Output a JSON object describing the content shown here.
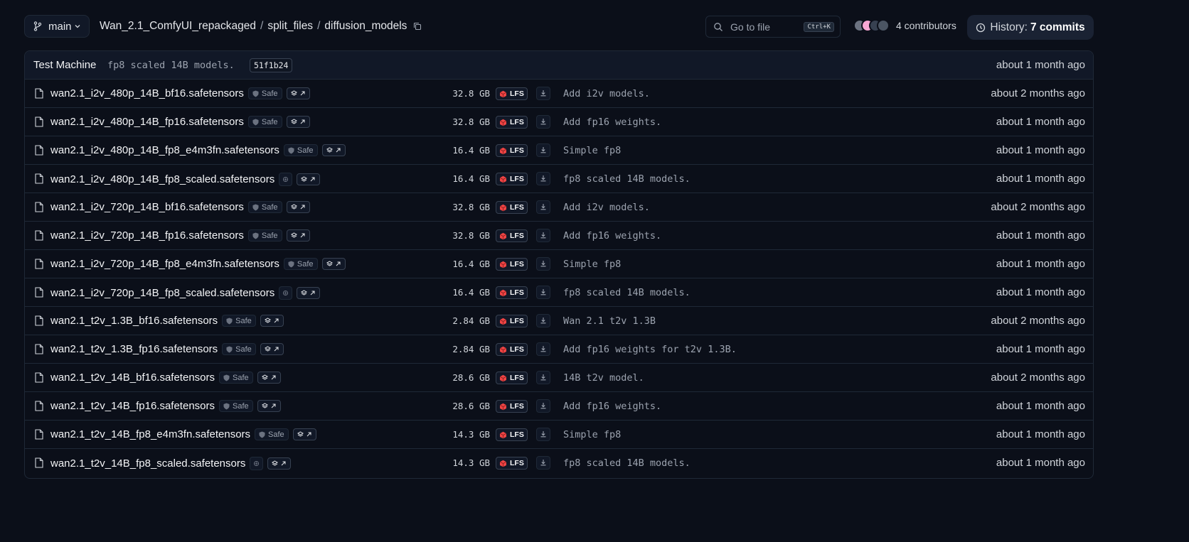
{
  "header": {
    "branch": "main",
    "breadcrumb": [
      "Wan_2.1_ComfyUI_repackaged",
      "split_files",
      "diffusion_models"
    ],
    "goto_placeholder": "Go to file",
    "goto_shortcut": "Ctrl+K",
    "contributors_label": "4 contributors",
    "history_label": "History:",
    "history_count": "7 commits"
  },
  "last_commit": {
    "author": "Test Machine",
    "message": "fp8 scaled 14B models.",
    "hash": "51f1b24",
    "date": "about 1 month ago"
  },
  "badges": {
    "safe": "Safe",
    "lfs": "LFS"
  },
  "colors": {
    "background": "#0b0f19",
    "lfs_cube": "#ef4444",
    "avatars": [
      "#6b7280",
      "#f9a8d4",
      "#374151",
      "#4b5563"
    ]
  },
  "files": [
    {
      "name": "wan2.1_i2v_480p_14B_bf16.safetensors",
      "safe": true,
      "size": "32.8 GB",
      "message": "Add i2v models.",
      "date": "about 2 months ago"
    },
    {
      "name": "wan2.1_i2v_480p_14B_fp16.safetensors",
      "safe": true,
      "size": "32.8 GB",
      "message": "Add fp16 weights.",
      "date": "about 1 month ago"
    },
    {
      "name": "wan2.1_i2v_480p_14B_fp8_e4m3fn.safetensors",
      "safe": true,
      "size": "16.4 GB",
      "message": "Simple fp8",
      "date": "about 1 month ago"
    },
    {
      "name": "wan2.1_i2v_480p_14B_fp8_scaled.safetensors",
      "safe": false,
      "size": "16.4 GB",
      "message": "fp8 scaled 14B models.",
      "date": "about 1 month ago"
    },
    {
      "name": "wan2.1_i2v_720p_14B_bf16.safetensors",
      "safe": true,
      "size": "32.8 GB",
      "message": "Add i2v models.",
      "date": "about 2 months ago"
    },
    {
      "name": "wan2.1_i2v_720p_14B_fp16.safetensors",
      "safe": true,
      "size": "32.8 GB",
      "message": "Add fp16 weights.",
      "date": "about 1 month ago"
    },
    {
      "name": "wan2.1_i2v_720p_14B_fp8_e4m3fn.safetensors",
      "safe": true,
      "size": "16.4 GB",
      "message": "Simple fp8",
      "date": "about 1 month ago"
    },
    {
      "name": "wan2.1_i2v_720p_14B_fp8_scaled.safetensors",
      "safe": false,
      "size": "16.4 GB",
      "message": "fp8 scaled 14B models.",
      "date": "about 1 month ago"
    },
    {
      "name": "wan2.1_t2v_1.3B_bf16.safetensors",
      "safe": true,
      "size": "2.84 GB",
      "message": "Wan 2.1 t2v 1.3B",
      "date": "about 2 months ago"
    },
    {
      "name": "wan2.1_t2v_1.3B_fp16.safetensors",
      "safe": true,
      "size": "2.84 GB",
      "message": "Add fp16 weights for t2v 1.3B.",
      "date": "about 1 month ago"
    },
    {
      "name": "wan2.1_t2v_14B_bf16.safetensors",
      "safe": true,
      "size": "28.6 GB",
      "message": "14B t2v model.",
      "date": "about 2 months ago"
    },
    {
      "name": "wan2.1_t2v_14B_fp16.safetensors",
      "safe": true,
      "size": "28.6 GB",
      "message": "Add fp16 weights.",
      "date": "about 1 month ago"
    },
    {
      "name": "wan2.1_t2v_14B_fp8_e4m3fn.safetensors",
      "safe": true,
      "size": "14.3 GB",
      "message": "Simple fp8",
      "date": "about 1 month ago"
    },
    {
      "name": "wan2.1_t2v_14B_fp8_scaled.safetensors",
      "safe": false,
      "size": "14.3 GB",
      "message": "fp8 scaled 14B models.",
      "date": "about 1 month ago"
    }
  ]
}
